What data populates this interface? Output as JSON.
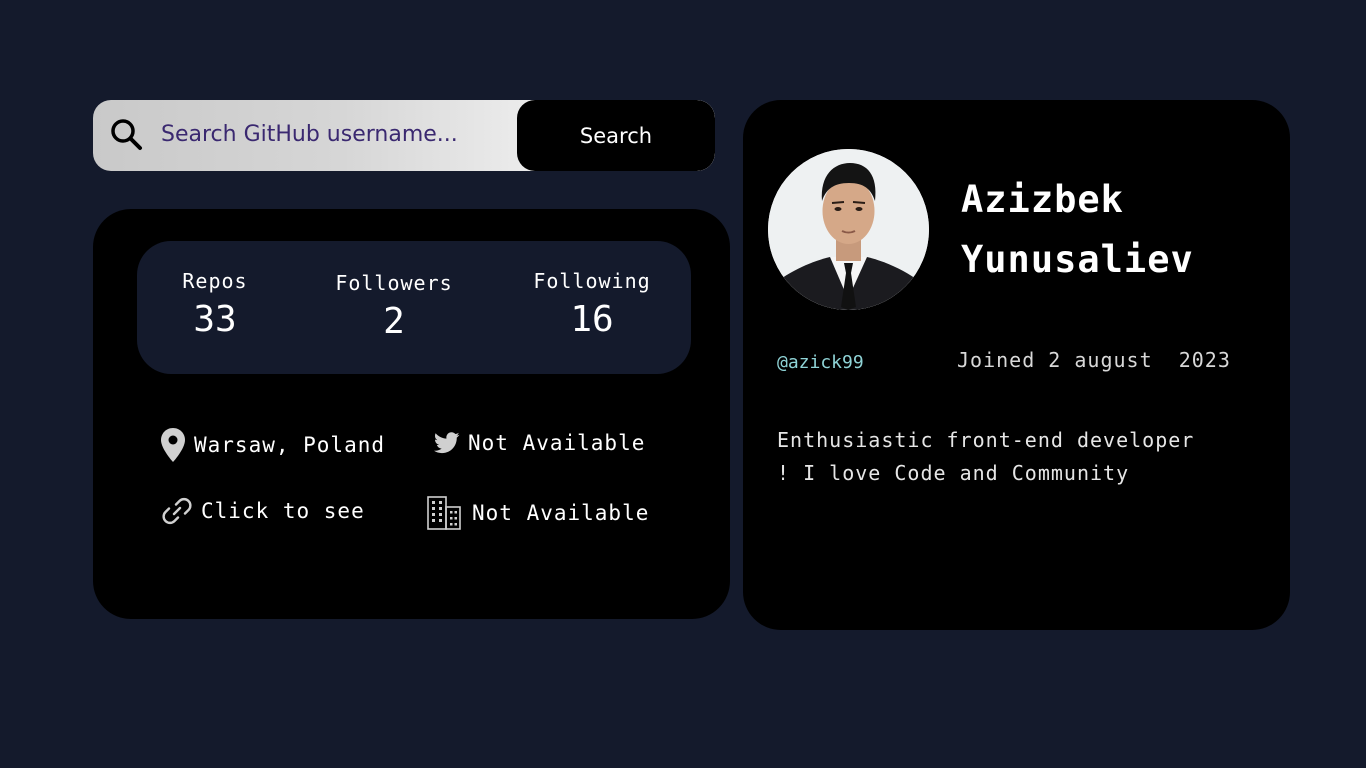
{
  "search": {
    "placeholder": "Search GitHub username...",
    "button_label": "Search"
  },
  "stats": {
    "repos_label": "Repos",
    "repos_value": "33",
    "followers_label": "Followers",
    "followers_value": "2",
    "following_label": "Following",
    "following_value": "16"
  },
  "info": {
    "location": "Warsaw, Poland",
    "twitter": "Not Available",
    "blog": "Click to see",
    "company": "Not Available",
    "icons": [
      "location-pin-icon",
      "twitter-icon",
      "link-icon",
      "company-building-icon"
    ]
  },
  "profile": {
    "name_first": "Azizbek",
    "name_last": "Yunusaliev",
    "login": "@azick99",
    "joined": "Joined 2 august  2023",
    "bio_line1": "Enthusiastic front-end developer",
    "bio_line2": "! I love Code and Community"
  },
  "colors": {
    "background": "#141a2c",
    "card": "#000000",
    "login_accent": "#8fd3d6",
    "placeholder_text": "#3a2870"
  }
}
